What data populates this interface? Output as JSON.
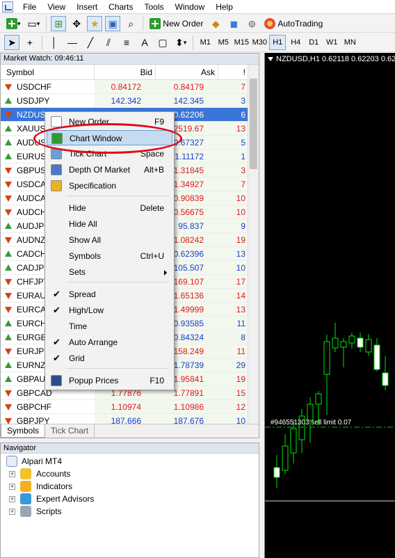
{
  "menubar": {
    "items": [
      "File",
      "View",
      "Insert",
      "Charts",
      "Tools",
      "Window",
      "Help"
    ]
  },
  "toolbar": {
    "new_order": "New Order",
    "autotrading": "AutoTrading"
  },
  "timeframes": [
    "M1",
    "M5",
    "M15",
    "M30",
    "H1",
    "H4",
    "D1",
    "W1",
    "MN"
  ],
  "active_timeframe": "H1",
  "market_watch": {
    "title": "Market Watch: 09:46:11",
    "columns": {
      "symbol": "Symbol",
      "bid": "Bid",
      "ask": "Ask",
      "spread": "!"
    },
    "rows": [
      {
        "symbol": "USDCHF",
        "bid": "0.84172",
        "ask": "0.84179",
        "spread": "7",
        "dir": "down",
        "bid_color": "red",
        "ask_color": "red"
      },
      {
        "symbol": "USDJPY",
        "bid": "142.342",
        "ask": "142.345",
        "spread": "3",
        "dir": "up",
        "bid_color": "blue",
        "ask_color": "blue"
      },
      {
        "symbol": "NZDUSD",
        "bid": "",
        "ask": "0.62206",
        "spread": "6",
        "dir": "down",
        "bid_color": "red",
        "ask_color": "red",
        "selected": true
      },
      {
        "symbol": "XAUUSD",
        "bid": "",
        "ask": "2519.67",
        "spread": "13",
        "dir": "up",
        "bid_color": "red",
        "ask_color": "red"
      },
      {
        "symbol": "AUDUSD",
        "bid": "",
        "ask": "0.67327",
        "spread": "5",
        "dir": "up",
        "bid_color": "blue",
        "ask_color": "blue"
      },
      {
        "symbol": "EURUSD",
        "bid": "",
        "ask": "1.11172",
        "spread": "1",
        "dir": "up",
        "bid_color": "blue",
        "ask_color": "blue"
      },
      {
        "symbol": "GBPUSD",
        "bid": "",
        "ask": "1.31845",
        "spread": "3",
        "dir": "down",
        "bid_color": "red",
        "ask_color": "red"
      },
      {
        "symbol": "USDCAD",
        "bid": "",
        "ask": "1.34927",
        "spread": "7",
        "dir": "down",
        "bid_color": "red",
        "ask_color": "red"
      },
      {
        "symbol": "AUDCAD",
        "bid": "",
        "ask": "0.90839",
        "spread": "10",
        "dir": "down",
        "bid_color": "red",
        "ask_color": "red"
      },
      {
        "symbol": "AUDCHF",
        "bid": "",
        "ask": "0.56675",
        "spread": "10",
        "dir": "down",
        "bid_color": "red",
        "ask_color": "red"
      },
      {
        "symbol": "AUDJPY",
        "bid": "",
        "ask": "95.837",
        "spread": "9",
        "dir": "up",
        "bid_color": "blue",
        "ask_color": "blue"
      },
      {
        "symbol": "AUDNZD",
        "bid": "",
        "ask": "1.08242",
        "spread": "19",
        "dir": "down",
        "bid_color": "red",
        "ask_color": "red"
      },
      {
        "symbol": "CADCHF",
        "bid": "",
        "ask": "0.62396",
        "spread": "13",
        "dir": "up",
        "bid_color": "blue",
        "ask_color": "blue"
      },
      {
        "symbol": "CADJPY",
        "bid": "",
        "ask": "105.507",
        "spread": "10",
        "dir": "up",
        "bid_color": "blue",
        "ask_color": "blue"
      },
      {
        "symbol": "CHFJPY",
        "bid": "",
        "ask": "169.107",
        "spread": "17",
        "dir": "down",
        "bid_color": "red",
        "ask_color": "red"
      },
      {
        "symbol": "EURAUD",
        "bid": "",
        "ask": "1.65136",
        "spread": "14",
        "dir": "down",
        "bid_color": "red",
        "ask_color": "red"
      },
      {
        "symbol": "EURCAD",
        "bid": "",
        "ask": "1.49999",
        "spread": "13",
        "dir": "down",
        "bid_color": "red",
        "ask_color": "red"
      },
      {
        "symbol": "EURCHF",
        "bid": "",
        "ask": "0.93585",
        "spread": "11",
        "dir": "up",
        "bid_color": "blue",
        "ask_color": "blue"
      },
      {
        "symbol": "EURGBP",
        "bid": "",
        "ask": "0.84324",
        "spread": "8",
        "dir": "up",
        "bid_color": "blue",
        "ask_color": "blue"
      },
      {
        "symbol": "EURJPY",
        "bid": "",
        "ask": "158.249",
        "spread": "11",
        "dir": "down",
        "bid_color": "red",
        "ask_color": "red"
      },
      {
        "symbol": "EURNZD",
        "bid": "",
        "ask": "1.78739",
        "spread": "29",
        "dir": "up",
        "bid_color": "blue",
        "ask_color": "blue"
      },
      {
        "symbol": "GBPAUD",
        "bid": "",
        "ask": "1.95841",
        "spread": "19",
        "dir": "up",
        "bid_color": "red",
        "ask_color": "red"
      },
      {
        "symbol": "GBPCAD",
        "bid": "1.77876",
        "ask": "1.77891",
        "spread": "15",
        "dir": "down",
        "bid_color": "red",
        "ask_color": "red"
      },
      {
        "symbol": "GBPCHF",
        "bid": "1.10974",
        "ask": "1.10986",
        "spread": "12",
        "dir": "down",
        "bid_color": "red",
        "ask_color": "red"
      },
      {
        "symbol": "GBPJPY",
        "bid": "187.666",
        "ask": "187.676",
        "spread": "10",
        "dir": "down",
        "bid_color": "blue",
        "ask_color": "blue"
      }
    ],
    "tabs": [
      "Symbols",
      "Tick Chart"
    ]
  },
  "navigator": {
    "title": "Navigator",
    "root": "Alpari MT4",
    "items": [
      "Accounts",
      "Indicators",
      "Expert Advisors",
      "Scripts"
    ]
  },
  "chart": {
    "title": "NZDUSD,H1  0.62118 0.62203 0.62117 0",
    "order_line_label": "#946551303 sell limit 0.07"
  },
  "context_menu": {
    "items": [
      {
        "label": "New Order",
        "shortcut": "F9",
        "icon": "new-order-icon"
      },
      {
        "label": "Chart Window",
        "shortcut": "",
        "icon": "chart-window-icon",
        "highlighted": true
      },
      {
        "label": "Tick Chart",
        "shortcut": "Space",
        "icon": "tick-chart-icon"
      },
      {
        "label": "Depth Of Market",
        "shortcut": "Alt+B",
        "icon": "depth-of-market-icon"
      },
      {
        "label": "Specification",
        "shortcut": "",
        "icon": "specification-icon"
      },
      {
        "label": "Hide",
        "shortcut": "Delete"
      },
      {
        "label": "Hide All",
        "shortcut": ""
      },
      {
        "label": "Show All",
        "shortcut": ""
      },
      {
        "label": "Symbols",
        "shortcut": "Ctrl+U"
      },
      {
        "label": "Sets",
        "shortcut": "",
        "submenu": true
      },
      {
        "label": "Spread",
        "shortcut": "",
        "checked": true
      },
      {
        "label": "High/Low",
        "shortcut": "",
        "checked": true
      },
      {
        "label": "Time",
        "shortcut": ""
      },
      {
        "label": "Auto Arrange",
        "shortcut": "",
        "checked": true
      },
      {
        "label": "Grid",
        "shortcut": "",
        "checked": true
      },
      {
        "label": "Popup Prices",
        "shortcut": "F10",
        "icon": "popup-prices-icon"
      }
    ]
  },
  "colors": {
    "up": "#3a9a3a",
    "down": "#d04418",
    "bid_red": "#e01818",
    "bid_blue": "#1a3ccc",
    "selection": "#3875d7",
    "annotation": "#e00b1a"
  }
}
